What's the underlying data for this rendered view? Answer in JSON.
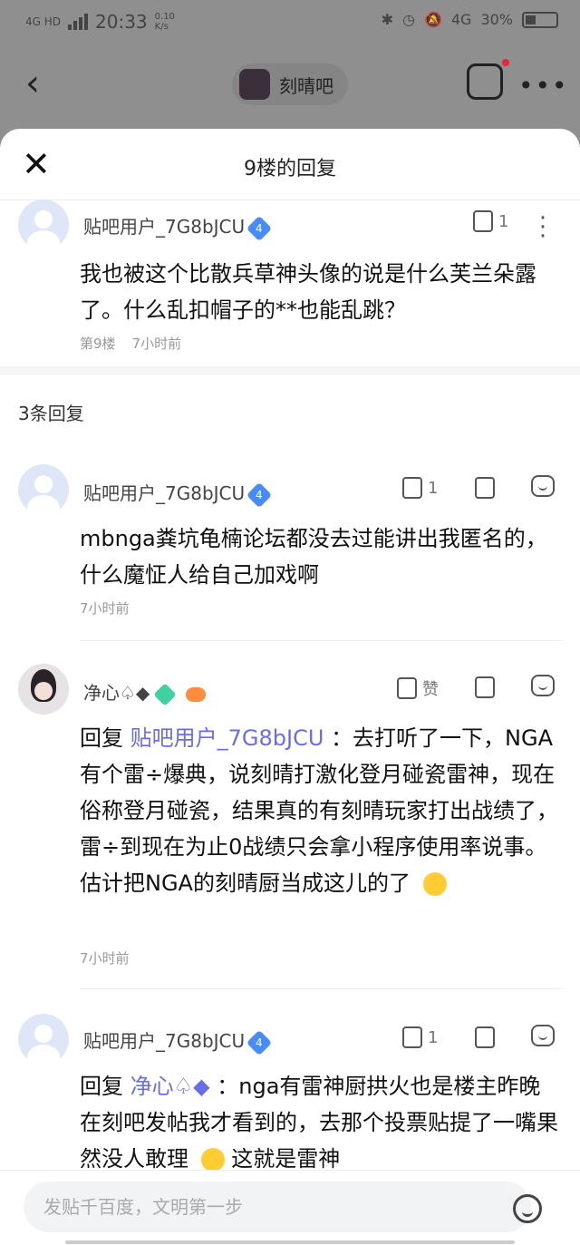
{
  "status_bar": {
    "network": "4G HD",
    "time": "20:33",
    "speed": "0.10 K/s",
    "network2": "4G",
    "battery": "30%"
  },
  "topbar": {
    "forum_name": "刻晴吧"
  },
  "sheet": {
    "title": "9楼的回复"
  },
  "main_post": {
    "username": "贴吧用户_7G8bJCU",
    "level": "4",
    "like_count": "1",
    "text": "我也被这个比散兵草神头像的说是什么芙兰朵露了。什么乱扣帽子的**也能乱跳？",
    "floor": "第9楼",
    "time": "7小时前"
  },
  "replies_count": "3条回复",
  "replies": [
    {
      "username": "贴吧用户_7G8bJCU",
      "level": "4",
      "like_count": "1",
      "text": "mbnga粪坑龟楠论坛都没去过能讲出我匿名的，什么魔怔人给自己加戏啊",
      "time": "7小时前"
    },
    {
      "username": "净心♤◆",
      "level": "1",
      "like_label": "赞",
      "reply_prefix": "回复",
      "reply_target": "贴吧用户_7G8bJCU",
      "text": "：去打听了一下，NGA有个雷÷爆典，说刻晴打激化登月碰瓷雷神，现在俗称登月碰瓷，结果真的有刻晴玩家打出战绩了，雷÷到现在为止0战绩只会拿小程序使用率说事。估计把NGA的刻晴厨当成这儿的了",
      "time": "7小时前"
    },
    {
      "username": "贴吧用户_7G8bJCU",
      "level": "4",
      "like_count": "1",
      "reply_prefix": "回复",
      "reply_target": "净心♤◆",
      "text": "：nga有雷神厨拱火也是楼主昨晚在刻吧发帖我才看到的，去那个投票贴提了一嘴果然没人敢理",
      "text_tail": "这就是雷神"
    }
  ],
  "input": {
    "placeholder": "发贴千百度，文明第一步"
  },
  "colors": {
    "link": "#6b6de6",
    "vip_badge": "#4a8cf7",
    "accent_red": "#e23"
  }
}
